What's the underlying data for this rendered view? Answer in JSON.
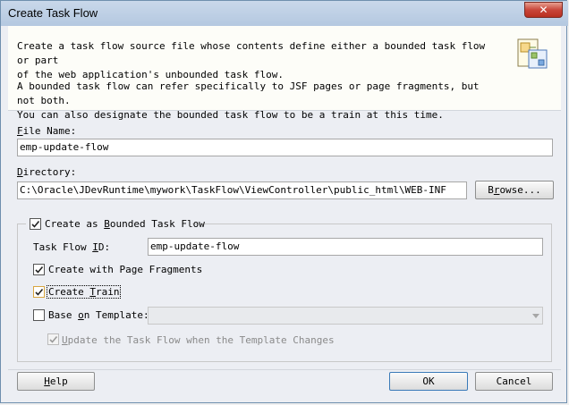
{
  "window": {
    "title": "Create Task Flow",
    "close_glyph": "✕"
  },
  "description": {
    "paragraph1": "Create a task flow source file whose contents define either a bounded task flow or part\nof the web application's unbounded task flow.",
    "paragraph2": "A bounded task flow can refer specifically to JSF pages or page fragments, but not both.\nYou can also designate the bounded task flow to be a train at this time.",
    "icon": "task-flow-wizard-icon"
  },
  "file_name": {
    "label_pre": "",
    "label_mnemonic": "F",
    "label_post": "ile Name:",
    "value": "emp-update-flow"
  },
  "directory": {
    "label_pre": "",
    "label_mnemonic": "D",
    "label_post": "irectory:",
    "value": "C:\\Oracle\\JDevRuntime\\mywork\\TaskFlow\\ViewController\\public_html\\WEB-INF",
    "browse_pre": "B",
    "browse_mnemonic": "r",
    "browse_post": "owse..."
  },
  "bounded": {
    "label_pre": "Create as ",
    "label_mnemonic": "B",
    "label_post": "ounded Task Flow",
    "checked": true
  },
  "task_flow_id": {
    "label_pre": "Task Flow ",
    "label_mnemonic": "I",
    "label_post": "D:",
    "value": "emp-update-flow"
  },
  "page_fragments": {
    "label": "Create with Page Fragments",
    "checked": true
  },
  "create_train": {
    "label_pre": "Create ",
    "label_mnemonic": "T",
    "label_post": "rain",
    "checked": true
  },
  "base_template": {
    "label_pre": "Base ",
    "label_mnemonic": "o",
    "label_post": "n Template:",
    "checked": false,
    "value": ""
  },
  "update_flow": {
    "label_pre": "",
    "label_mnemonic": "U",
    "label_post": "pdate the Task Flow when the Template Changes",
    "checked": true
  },
  "buttons": {
    "help_pre": "",
    "help_mnemonic": "H",
    "help_post": "elp",
    "ok": "OK",
    "cancel": "Cancel"
  },
  "colors": {
    "titlebar": "#c0d1e6",
    "close": "#c9463a",
    "focus_check": "#d9a640"
  }
}
